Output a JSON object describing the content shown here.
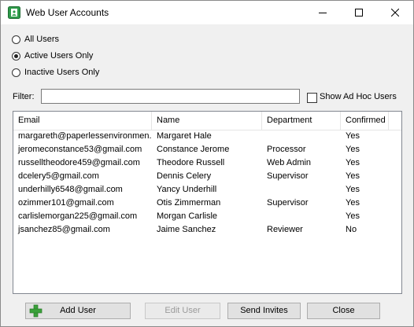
{
  "window": {
    "title": "Web User Accounts",
    "controls": [
      "minimize-icon",
      "maximize-icon",
      "close-icon"
    ]
  },
  "filters": {
    "options": [
      {
        "label": "All Users",
        "selected": false
      },
      {
        "label": "Active Users Only",
        "selected": true
      },
      {
        "label": "Inactive Users Only",
        "selected": false
      }
    ],
    "filter_label": "Filter:",
    "filter_value": "",
    "show_ad_hoc_label": "Show Ad Hoc Users",
    "show_ad_hoc_checked": false
  },
  "table": {
    "columns": [
      "Email",
      "Name",
      "Department",
      "Confirmed"
    ],
    "rows": [
      {
        "email": "margareth@paperlessenvironmen...",
        "name": "Margaret Hale",
        "department": "",
        "confirmed": "Yes"
      },
      {
        "email": "jeromeconstance53@gmail.com",
        "name": "Constance Jerome",
        "department": "Processor",
        "confirmed": "Yes"
      },
      {
        "email": "russelltheodore459@gmail.com",
        "name": "Theodore Russell",
        "department": "Web Admin",
        "confirmed": "Yes"
      },
      {
        "email": "dcelery5@gmail.com",
        "name": "Dennis Celery",
        "department": "Supervisor",
        "confirmed": "Yes"
      },
      {
        "email": "underhilly6548@gmail.com",
        "name": "Yancy Underhill",
        "department": "",
        "confirmed": "Yes"
      },
      {
        "email": "ozimmer101@gmail.com",
        "name": "Otis Zimmerman",
        "department": "Supervisor",
        "confirmed": "Yes"
      },
      {
        "email": "carlislemorgan225@gmail.com",
        "name": "Morgan Carlisle",
        "department": "",
        "confirmed": "Yes"
      },
      {
        "email": "jsanchez85@gmail.com",
        "name": "Jaime Sanchez",
        "department": "Reviewer",
        "confirmed": "No"
      }
    ]
  },
  "buttons": {
    "add_user": "Add User",
    "edit_user": "Edit User",
    "send_invites": "Send Invites",
    "close": "Close"
  },
  "colors": {
    "accent_green": "#3aa13a",
    "app_icon_green": "#2e9b4a"
  }
}
